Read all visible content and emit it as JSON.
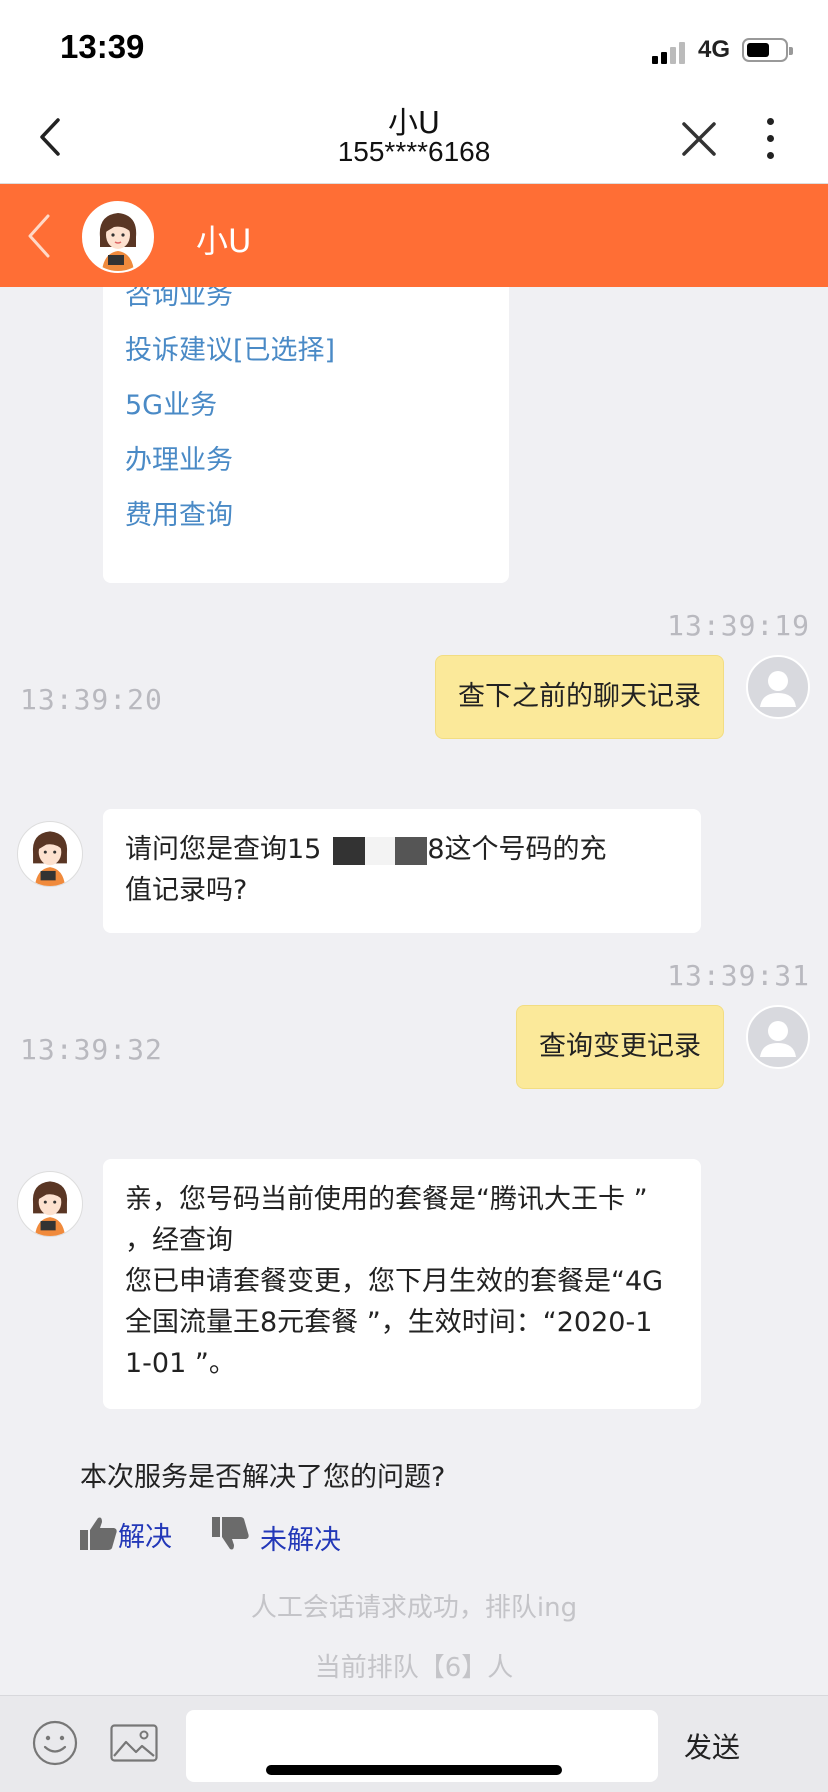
{
  "status_bar": {
    "time": "13:39",
    "network": "4G"
  },
  "nav": {
    "title": "小U",
    "subtitle": "155****6168"
  },
  "header": {
    "agent_name": "小U"
  },
  "menu": {
    "items": [
      "咨询业务",
      "投诉建议[已选择]",
      "5G业务",
      "办理业务",
      "费用查询"
    ]
  },
  "messages": [
    {
      "from": "user",
      "time": "13:39:19",
      "text": "查下之前的聊天记录"
    },
    {
      "from": "bot",
      "time": "13:39:20",
      "text_before_mask": "请问您是查询15",
      "text_after_mask": "8这个号码的充",
      "text_line2": "值记录吗?"
    },
    {
      "from": "user",
      "time": "13:39:31",
      "text": "查询变更记录"
    },
    {
      "from": "bot",
      "time": "13:39:32",
      "lines": [
        "亲，您号码当前使用的套餐是“腾讯大王卡 ”",
        "，经查询",
        "您已申请套餐变更，您下月生效的套餐是“4G",
        "全国流量王8元套餐 ”，生效时间：“2020-1",
        "1-01 ”。"
      ]
    }
  ],
  "feedback": {
    "question": "本次服务是否解决了您的问题?",
    "resolved": "解决",
    "unresolved": "未解决"
  },
  "system": {
    "queue_success": "人工会话请求成功，排队ing",
    "queue_count": "当前排队【6】人"
  },
  "input": {
    "placeholder": "",
    "send_label": "发送"
  },
  "colors": {
    "header_orange": "#ff6e35",
    "user_bubble": "#fbe99a",
    "link_blue": "#4a8ac6",
    "feedback_blue": "#2338b8"
  }
}
